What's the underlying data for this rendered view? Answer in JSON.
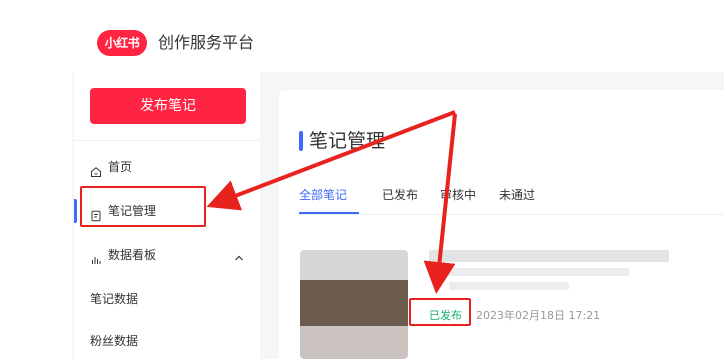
{
  "header": {
    "logo_text": "小红书",
    "platform_title": "创作服务平台"
  },
  "sidebar": {
    "publish_button": "发布笔记",
    "items": [
      {
        "label": "首页",
        "icon": "home-icon"
      },
      {
        "label": "笔记管理",
        "icon": "note-icon",
        "active": true
      },
      {
        "label": "数据看板",
        "icon": "bar-chart-icon",
        "expanded": true
      }
    ],
    "sub_items": [
      {
        "label": "笔记数据"
      },
      {
        "label": "粉丝数据"
      }
    ]
  },
  "main": {
    "title": "笔记管理",
    "tabs": [
      {
        "label": "全部笔记",
        "active": true
      },
      {
        "label": "已发布"
      },
      {
        "label": "审核中"
      },
      {
        "label": "未通过"
      }
    ],
    "note": {
      "status": "已发布",
      "time": "2023年02月18日 17:21"
    }
  },
  "colors": {
    "brand_red": "#ff2442",
    "accent_blue": "#3d6bff",
    "status_green": "#15b26b",
    "annotation_red": "#e8231f"
  }
}
